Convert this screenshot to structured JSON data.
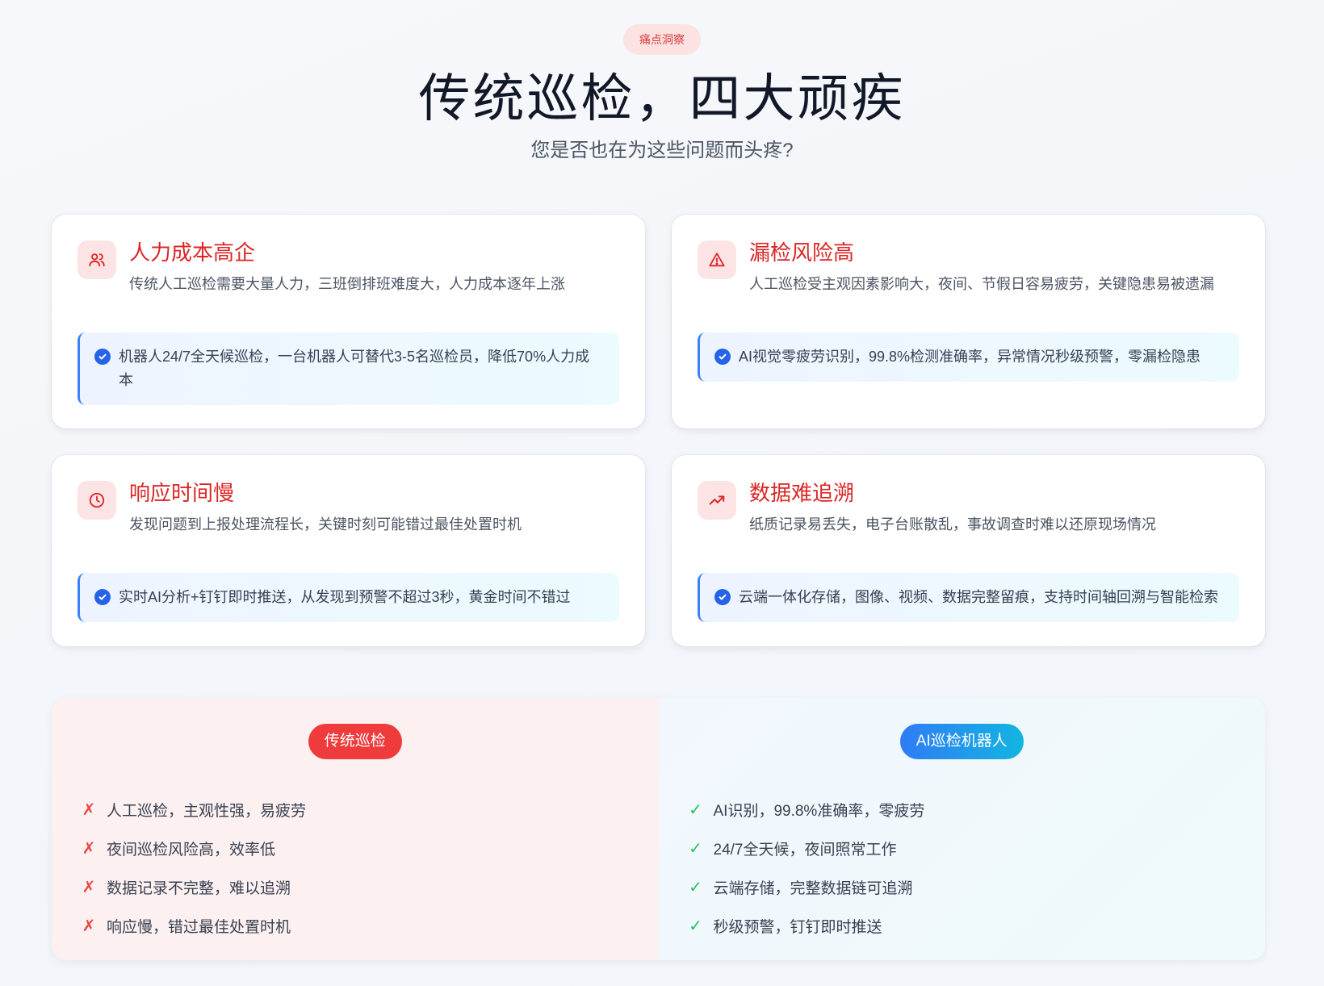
{
  "header": {
    "badge": "痛点洞察",
    "title": "传统巡检，四大顽疾",
    "subtitle": "您是否也在为这些问题而头疼?"
  },
  "cards": [
    {
      "icon": "users-icon",
      "title": "人力成本高企",
      "desc": "传统人工巡检需要大量人力，三班倒排班难度大，人力成本逐年上涨",
      "solution": "机器人24/7全天候巡检，一台机器人可替代3-5名巡检员，降低70%人力成本"
    },
    {
      "icon": "warning-icon",
      "title": "漏检风险高",
      "desc": "人工巡检受主观因素影响大，夜间、节假日容易疲劳，关键隐患易被遗漏",
      "solution": "AI视觉零疲劳识别，99.8%检测准确率，异常情况秒级预警，零漏检隐患"
    },
    {
      "icon": "clock-icon",
      "title": "响应时间慢",
      "desc": "发现问题到上报处理流程长，关键时刻可能错过最佳处置时机",
      "solution": "实时AI分析+钉钉即时推送，从发现到预警不超过3秒，黄金时间不错过"
    },
    {
      "icon": "trending-icon",
      "title": "数据难追溯",
      "desc": "纸质记录易丢失，电子台账散乱，事故调查时难以还原现场情况",
      "solution": "云端一体化存储，图像、视频、数据完整留痕，支持时间轴回溯与智能检索"
    }
  ],
  "compare": {
    "left": {
      "label": "传统巡检",
      "items": [
        "人工巡检，主观性强，易疲劳",
        "夜间巡检风险高，效率低",
        "数据记录不完整，难以追溯",
        "响应慢，错过最佳处置时机"
      ],
      "mark": "✗"
    },
    "right": {
      "label": "AI巡检机器人",
      "items": [
        "AI识别，99.8%准确率，零疲劳",
        "24/7全天候，夜间照常工作",
        "云端存储，完整数据链可追溯",
        "秒级预警，钉钉即时推送"
      ],
      "mark": "✓"
    }
  },
  "colors": {
    "accent_red": "#dc2626",
    "accent_blue": "#2563eb",
    "check_green": "#22c55e"
  }
}
